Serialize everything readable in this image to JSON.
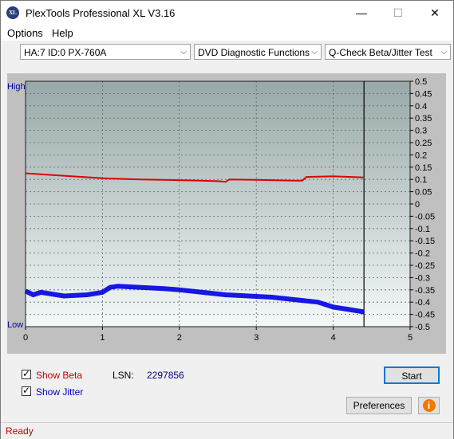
{
  "window": {
    "title": "PlexTools Professional XL V3.16",
    "icon_text": "XL",
    "minimize_glyph": "—",
    "maximize_glyph": "☐",
    "close_glyph": "✕"
  },
  "menu": {
    "options": "Options",
    "help": "Help"
  },
  "toolbar": {
    "drive": "HA:7 ID:0  PX-760A",
    "function": "DVD Diagnostic Functions",
    "test": "Q-Check Beta/Jitter Test"
  },
  "chart": {
    "high_label": "High",
    "low_label": "Low"
  },
  "chart_data": {
    "type": "line",
    "x_ticks": [
      "0",
      "1",
      "2",
      "3",
      "4",
      "5"
    ],
    "xlim": [
      0,
      5
    ],
    "y_right_ticks": [
      "0.5",
      "0.45",
      "0.4",
      "0.35",
      "0.3",
      "0.25",
      "0.2",
      "0.15",
      "0.1",
      "0.05",
      "0",
      "-0.05",
      "-0.1",
      "-0.15",
      "-0.2",
      "-0.25",
      "-0.3",
      "-0.35",
      "-0.4",
      "-0.45",
      "-0.5"
    ],
    "ylim": [
      -0.5,
      0.5
    ],
    "grid": true,
    "end_marker_x": 4.4,
    "series": [
      {
        "color": "#e00000",
        "x": [
          0,
          0.5,
          1.0,
          1.5,
          2.0,
          2.5,
          2.6,
          2.65,
          3.0,
          3.5,
          3.6,
          3.65,
          4.0,
          4.4
        ],
        "values": [
          0.125,
          0.115,
          0.105,
          0.1,
          0.097,
          0.093,
          0.09,
          0.1,
          0.098,
          0.095,
          0.095,
          0.11,
          0.113,
          0.108
        ]
      },
      {
        "color": "#0000e0",
        "x": [
          0,
          0.1,
          0.2,
          0.5,
          0.8,
          1.0,
          1.1,
          1.2,
          1.5,
          1.8,
          2.0,
          2.3,
          2.6,
          2.9,
          3.2,
          3.5,
          3.8,
          4.0,
          4.2,
          4.4
        ],
        "values": [
          -0.355,
          -0.37,
          -0.36,
          -0.375,
          -0.37,
          -0.36,
          -0.34,
          -0.335,
          -0.34,
          -0.345,
          -0.35,
          -0.36,
          -0.37,
          -0.375,
          -0.38,
          -0.39,
          -0.4,
          -0.42,
          -0.43,
          -0.44
        ]
      }
    ]
  },
  "controls": {
    "show_beta": "Show Beta",
    "show_jitter": "Show Jitter",
    "lsn_label": "LSN:",
    "lsn_value": "2297856",
    "start": "Start",
    "preferences": "Preferences",
    "info_glyph": "i"
  },
  "status": {
    "text": "Ready"
  },
  "colors": {
    "beta_label": "#c00000",
    "jitter_label": "#0000c0",
    "status_text": "#c00000",
    "plot_top": "#98a8a8",
    "plot_bottom": "#f4f8f8"
  }
}
